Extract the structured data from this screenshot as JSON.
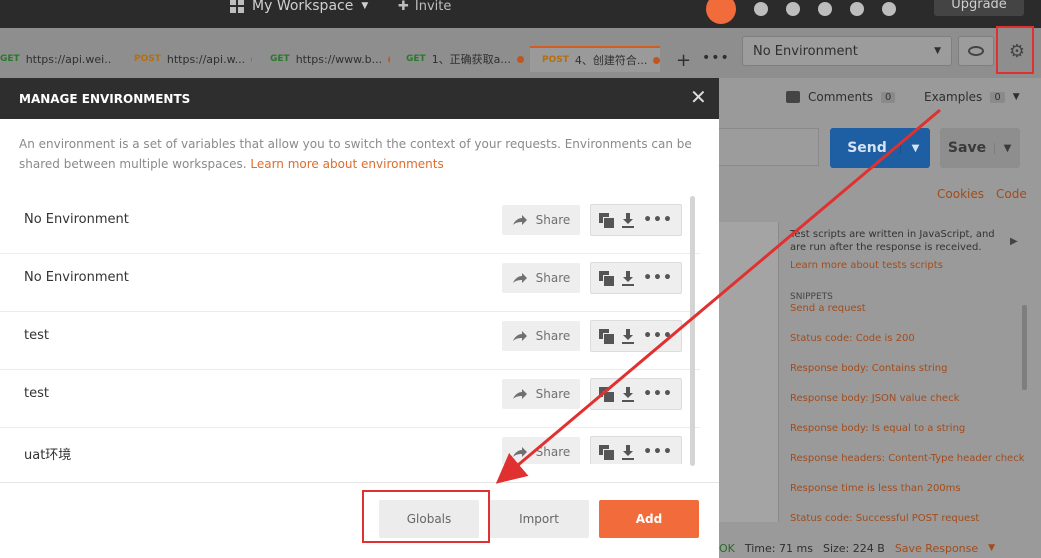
{
  "topbar": {
    "workspace": "My Workspace",
    "invite": "Invite",
    "upgrade": "Upgrade"
  },
  "tabs": [
    {
      "method": "GET",
      "label": "https://api.wei..."
    },
    {
      "method": "POST",
      "label": "https://api.w..."
    },
    {
      "method": "GET",
      "label": "https://www.b..."
    },
    {
      "method": "GET",
      "label": "1、正确获取a..."
    },
    {
      "method": "POST",
      "label": "4、创建符合..."
    }
  ],
  "environment_select": "No Environment",
  "request": {
    "comments_label": "Comments",
    "comments_count": "0",
    "examples_label": "Examples",
    "examples_count": "0",
    "send_label": "Send",
    "save_label": "Save",
    "cookies_label": "Cookies",
    "code_label": "Code"
  },
  "snippets": {
    "description": "Test scripts are written in JavaScript, and are run after the response is received.",
    "learn_more": "Learn more about tests scripts",
    "title": "SNIPPETS",
    "items": [
      "Send a request",
      "Status code: Code is 200",
      "Response body: Contains string",
      "Response body: JSON value check",
      "Response body: Is equal to a string",
      "Response headers: Content-Type header check",
      "Response time is less than 200ms",
      "Status code: Successful POST request"
    ]
  },
  "statusbar": {
    "status": "OK",
    "time_label": "Time:",
    "time_value": "71 ms",
    "size_label": "Size:",
    "size_value": "224 B",
    "save_response": "Save Response"
  },
  "modal": {
    "title": "MANAGE ENVIRONMENTS",
    "description": "An environment is a set of variables that allow you to switch the context of your requests. Environments can be shared between multiple workspaces.",
    "learn_more": "Learn more about environments",
    "share_label": "Share",
    "environments": [
      "No Environment",
      "No Environment",
      "test",
      "test",
      "uat环境"
    ],
    "globals_label": "Globals",
    "import_label": "Import",
    "add_label": "Add"
  },
  "colors": {
    "accent": "#f26b3a",
    "send_blue": "#1e5ea3",
    "annotation_red": "#e03030"
  }
}
